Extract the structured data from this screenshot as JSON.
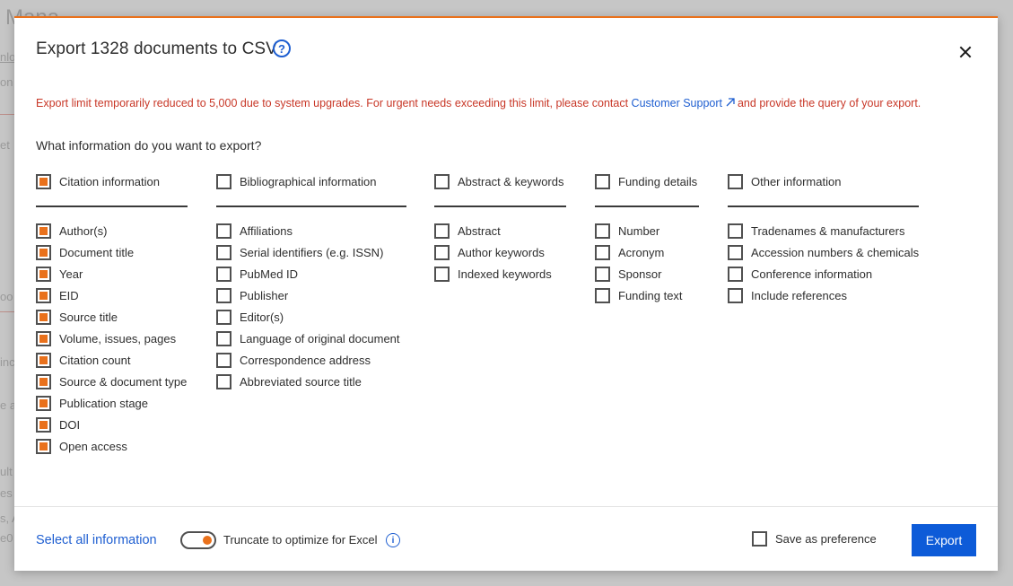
{
  "background": {
    "fragments": [
      "Mana",
      "nlo",
      "on",
      "et",
      "oo",
      "inc",
      "e a",
      "ult",
      "es",
      "s, Al",
      "e0"
    ]
  },
  "modal": {
    "title": "Export 1328 documents to CSV",
    "help_icon": "question-circle-icon",
    "close_icon": "close-icon",
    "warning_before": "Export limit temporarily reduced to 5,000 due to system upgrades. For urgent needs exceeding this limit, please contact ",
    "warning_link": "Customer Support",
    "warning_after": "and provide the query of your export.",
    "question": "What information do you want to export?",
    "columns": [
      {
        "header": {
          "label": "Citation information",
          "checked": true
        },
        "items": [
          {
            "label": "Author(s)",
            "checked": true
          },
          {
            "label": "Document title",
            "checked": true
          },
          {
            "label": "Year",
            "checked": true
          },
          {
            "label": "EID",
            "checked": true
          },
          {
            "label": "Source title",
            "checked": true
          },
          {
            "label": "Volume, issues, pages",
            "checked": true
          },
          {
            "label": "Citation count",
            "checked": true
          },
          {
            "label": "Source & document type",
            "checked": true
          },
          {
            "label": "Publication stage",
            "checked": true
          },
          {
            "label": "DOI",
            "checked": true
          },
          {
            "label": "Open access",
            "checked": true
          }
        ]
      },
      {
        "header": {
          "label": "Bibliographical information",
          "checked": false
        },
        "items": [
          {
            "label": "Affiliations",
            "checked": false
          },
          {
            "label": "Serial identifiers (e.g. ISSN)",
            "checked": false
          },
          {
            "label": "PubMed ID",
            "checked": false
          },
          {
            "label": "Publisher",
            "checked": false
          },
          {
            "label": "Editor(s)",
            "checked": false
          },
          {
            "label": "Language of original document",
            "checked": false
          },
          {
            "label": "Correspondence address",
            "checked": false
          },
          {
            "label": "Abbreviated source title",
            "checked": false
          }
        ]
      },
      {
        "header": {
          "label": "Abstract & keywords",
          "checked": false
        },
        "items": [
          {
            "label": "Abstract",
            "checked": false
          },
          {
            "label": "Author keywords",
            "checked": false
          },
          {
            "label": "Indexed keywords",
            "checked": false
          }
        ]
      },
      {
        "header": {
          "label": "Funding details",
          "checked": false
        },
        "items": [
          {
            "label": "Number",
            "checked": false
          },
          {
            "label": "Acronym",
            "checked": false
          },
          {
            "label": "Sponsor",
            "checked": false
          },
          {
            "label": "Funding text",
            "checked": false
          }
        ]
      },
      {
        "header": {
          "label": "Other information",
          "checked": false
        },
        "items": [
          {
            "label": "Tradenames & manufacturers",
            "checked": false
          },
          {
            "label": "Accession numbers & chemicals",
            "checked": false
          },
          {
            "label": "Conference information",
            "checked": false
          },
          {
            "label": "Include references",
            "checked": false
          }
        ]
      }
    ],
    "footer": {
      "select_all": "Select all information",
      "truncate_label": "Truncate to optimize for Excel",
      "truncate_on": true,
      "save_pref_label": "Save as preference",
      "save_pref_checked": false,
      "export_label": "Export"
    }
  },
  "colors": {
    "accent": "#e9711c",
    "link": "#1f5fd1",
    "warning": "#c83727",
    "button": "#0d5bd8"
  }
}
